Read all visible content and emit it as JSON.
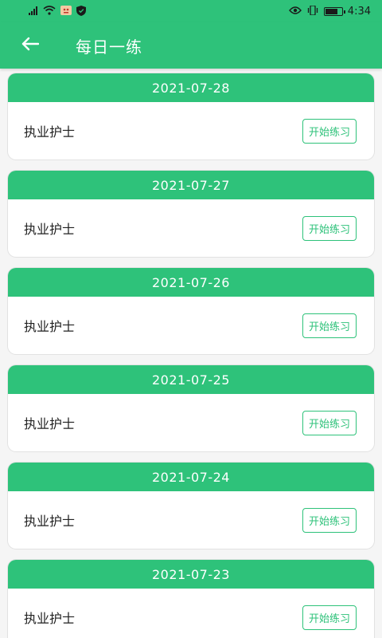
{
  "status_bar": {
    "time": "4:34",
    "icons": [
      "signal-icon",
      "wifi-icon",
      "app-notification-icon",
      "shield-icon",
      "eye-icon",
      "vibrate-icon",
      "battery-icon"
    ],
    "battery_level": 0.7
  },
  "toolbar": {
    "title": "每日一练",
    "back_icon": "arrow-left-icon"
  },
  "colors": {
    "primary": "#2ec27a",
    "background": "#f5f5f5"
  },
  "items": [
    {
      "date": "2021-07-28",
      "title": "执业护士",
      "button": "开始练习"
    },
    {
      "date": "2021-07-27",
      "title": "执业护士",
      "button": "开始练习"
    },
    {
      "date": "2021-07-26",
      "title": "执业护士",
      "button": "开始练习"
    },
    {
      "date": "2021-07-25",
      "title": "执业护士",
      "button": "开始练习"
    },
    {
      "date": "2021-07-24",
      "title": "执业护士",
      "button": "开始练习"
    },
    {
      "date": "2021-07-23",
      "title": "执业护士",
      "button": "开始练习"
    }
  ]
}
